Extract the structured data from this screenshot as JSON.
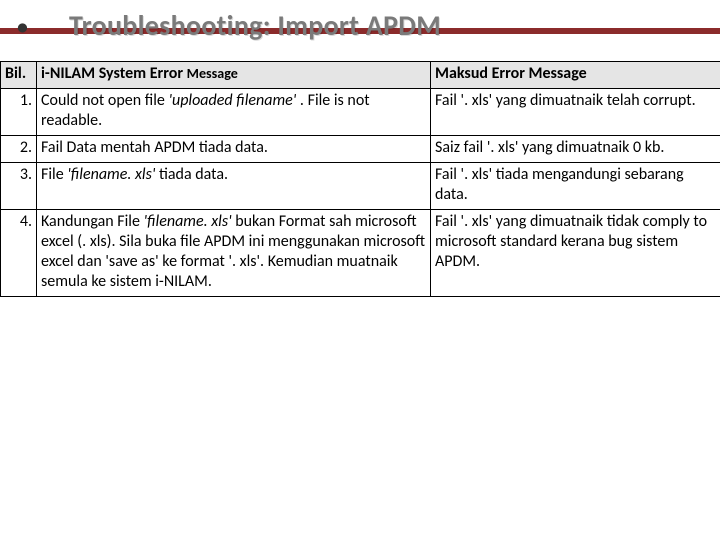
{
  "header": {
    "bullet": "•",
    "title": "Troubleshooting: Import APDM"
  },
  "table": {
    "headers": {
      "bil": "Bil.",
      "msg_pre": "i-NILAM System Error ",
      "msg_sub": "Message",
      "meaning": "Maksud Error Message"
    },
    "rows": [
      {
        "bil": "1.",
        "msg_a": "Could not open file ",
        "msg_i": "'uploaded filename'",
        "msg_b": " . File is not readable.",
        "meaning": "Fail '. xls' yang dimuatnaik telah corrupt."
      },
      {
        "bil": "2.",
        "msg_a": "Fail Data mentah APDM tiada data.",
        "msg_i": "",
        "msg_b": "",
        "meaning": "Saiz fail '. xls' yang dimuatnaik 0 kb."
      },
      {
        "bil": "3.",
        "msg_a": "File ",
        "msg_i": "'filename. xls'",
        "msg_b": "  tiada data.",
        "meaning": "Fail '. xls' tiada mengandungi sebarang data."
      },
      {
        "bil": "4.",
        "msg_a": "Kandungan File ",
        "msg_i": "'filename. xls'",
        "msg_b": "  bukan Format sah microsoft excel (. xls). Sila buka file APDM ini menggunakan microsoft excel dan 'save as' ke format '. xls'. Kemudian muatnaik semula ke sistem i-NILAM.",
        "meaning": "Fail '. xls' yang dimuatnaik tidak comply to microsoft standard kerana bug sistem APDM."
      }
    ]
  }
}
